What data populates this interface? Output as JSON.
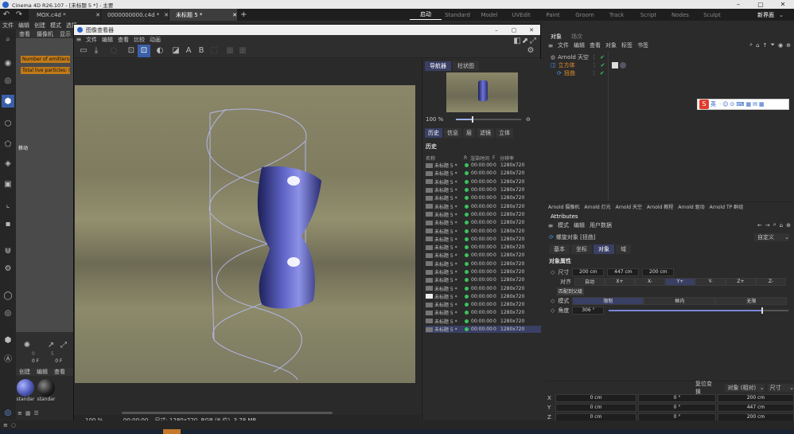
{
  "titlebar": {
    "app_title": "Cinema 4D R26.107 - [未标题 5 *] - 主要"
  },
  "doc_tabs": [
    "MOX.c4d *",
    "0000000000.c4d *",
    "未标题 5 *"
  ],
  "layouts": [
    "启动",
    "Standard",
    "Model",
    "UVEdit",
    "Paint",
    "Groom",
    "Track",
    "Script",
    "Nodes",
    "Sculpt"
  ],
  "layout_active": "启动",
  "new_layout": "新界面",
  "main_menu": [
    "文件",
    "编辑",
    "创建",
    "模式",
    "选择"
  ],
  "viewport_menu": [
    "查看",
    "摄像机",
    "显示"
  ],
  "hud": {
    "emitters": "Number of emitters: 0",
    "particles": "Total live particles: 0"
  },
  "move_label": "移动",
  "timeline": {
    "frame_a": "0",
    "frame_b": "5",
    "field_a": "0 F",
    "field_b": "0 F"
  },
  "material_menu": [
    "创建",
    "编辑",
    "查看"
  ],
  "materials": [
    "standar",
    "standar"
  ],
  "picture_viewer": {
    "title": "图像查看器",
    "menu": [
      "文件",
      "编辑",
      "查看",
      "比较",
      "动画"
    ],
    "toolbar_letters": [
      "A",
      "B"
    ],
    "zoom": "100 %",
    "time": "00:00:00",
    "status": "尺寸: 1280x720, RGB (8 位), 3.78 MB",
    "side_tabs": [
      "导航器",
      "柱状图"
    ],
    "nav_zoom": "100 %",
    "hist_tabs": [
      "历史",
      "信息",
      "层",
      "滤镜",
      "立体"
    ],
    "history_title": "历史",
    "columns": [
      "名称",
      "R",
      "渲染时间",
      "F",
      "分辨率"
    ],
    "rows": [
      {
        "name": "未标题 5 *",
        "time": "00:00:00",
        "f": "0",
        "res": "1280x720"
      },
      {
        "name": "未标题 5 *",
        "time": "00:00:00",
        "f": "0",
        "res": "1280x720"
      },
      {
        "name": "未标题 5 *",
        "time": "00:00:00",
        "f": "0",
        "res": "1280x720"
      },
      {
        "name": "未标题 5 *",
        "time": "00:00:00",
        "f": "0",
        "res": "1280x720"
      },
      {
        "name": "未标题 5 *",
        "time": "00:00:00",
        "f": "0",
        "res": "1280x720"
      },
      {
        "name": "未标题 5 *",
        "time": "00:00:00",
        "f": "0",
        "res": "1280x720"
      },
      {
        "name": "未标题 5 *",
        "time": "00:00:00",
        "f": "0",
        "res": "1280x720"
      },
      {
        "name": "未标题 5 *",
        "time": "00:00:00",
        "f": "0",
        "res": "1280x720"
      },
      {
        "name": "未标题 5 *",
        "time": "00:00:00",
        "f": "0",
        "res": "1280x720"
      },
      {
        "name": "未标题 5 *",
        "time": "00:00:00",
        "f": "0",
        "res": "1280x720"
      },
      {
        "name": "未标题 5 *",
        "time": "00:00:00",
        "f": "0",
        "res": "1280x720"
      },
      {
        "name": "未标题 5 *",
        "time": "00:00:00",
        "f": "0",
        "res": "1280x720"
      },
      {
        "name": "未标题 5 *",
        "time": "00:00:00",
        "f": "0",
        "res": "1280x720"
      },
      {
        "name": "未标题 5 *",
        "time": "00:00:00",
        "f": "0",
        "res": "1280x720"
      },
      {
        "name": "未标题 5 *",
        "time": "00:00:00",
        "f": "0",
        "res": "1280x720"
      },
      {
        "name": "未标题 5 *",
        "time": "00:00:00",
        "f": "0",
        "res": "1280x720"
      },
      {
        "name": "未标题 5 *",
        "time": "00:00:00",
        "f": "0",
        "res": "1280x720"
      },
      {
        "name": "未标题 5 *",
        "time": "00:00:00",
        "f": "0",
        "res": "1280x720"
      },
      {
        "name": "未标题 5 *",
        "time": "00:00:00",
        "f": "0",
        "res": "1280x720"
      },
      {
        "name": "未标题 5 *",
        "time": "00:00:00",
        "f": "0",
        "res": "1280x720"
      },
      {
        "name": "未标题 5 *",
        "time": "00:00:00",
        "f": "0",
        "res": "1280x720"
      }
    ]
  },
  "objects_panel": {
    "tabs": [
      "对象",
      "场次"
    ],
    "menu": [
      "文件",
      "编辑",
      "查看",
      "对象",
      "标签",
      "书签"
    ],
    "items": [
      "Arnold 天空",
      "立方体",
      "扭曲"
    ]
  },
  "ime_label": "英",
  "arnold_bar": [
    "Arnold 摄像机",
    "Arnold 灯光",
    "Arnold 天空",
    "Arnold 教程",
    "Arnold 驱动",
    "Arnold TP 群组"
  ],
  "attributes": {
    "title": "Attributes",
    "menu": [
      "模式",
      "编辑",
      "用户数据"
    ],
    "object_name": "螺旋对象 [扭曲]",
    "preset": "自定义",
    "tabs": [
      "基本",
      "坐标",
      "对象",
      "域"
    ],
    "active_tab": "对象",
    "section": "对象属性",
    "size_label": "尺寸",
    "size": [
      "200 cm",
      "447 cm",
      "200 cm"
    ],
    "align_label": "对齐",
    "align_opts": [
      "自动",
      "X+",
      "X-",
      "Y+",
      "Y-",
      "Z+",
      "Z-"
    ],
    "fit_button": "匹配到父级",
    "mode_label": "模式",
    "mode_opts": [
      "限制",
      "框内",
      "无限"
    ],
    "angle_label": "角度",
    "angle": "306 °",
    "angle_fraction": 0.85
  },
  "coords": {
    "reset_button": "复位变换",
    "dropdown_a": "对象 (相对)",
    "dropdown_b": "尺寸",
    "rows": [
      {
        "axis": "X",
        "pos": "0 cm",
        "rot": "0 °",
        "size": "200 cm"
      },
      {
        "axis": "Y",
        "pos": "0 cm",
        "rot": "0 °",
        "size": "447 cm"
      },
      {
        "axis": "Z",
        "pos": "0 cm",
        "rot": "0 °",
        "size": "200 cm"
      }
    ]
  },
  "colors": {
    "accent": "#3a3f64",
    "check": "#3cc35b",
    "hud": "#c07a1a",
    "active_layout": "#e2e2e2"
  }
}
